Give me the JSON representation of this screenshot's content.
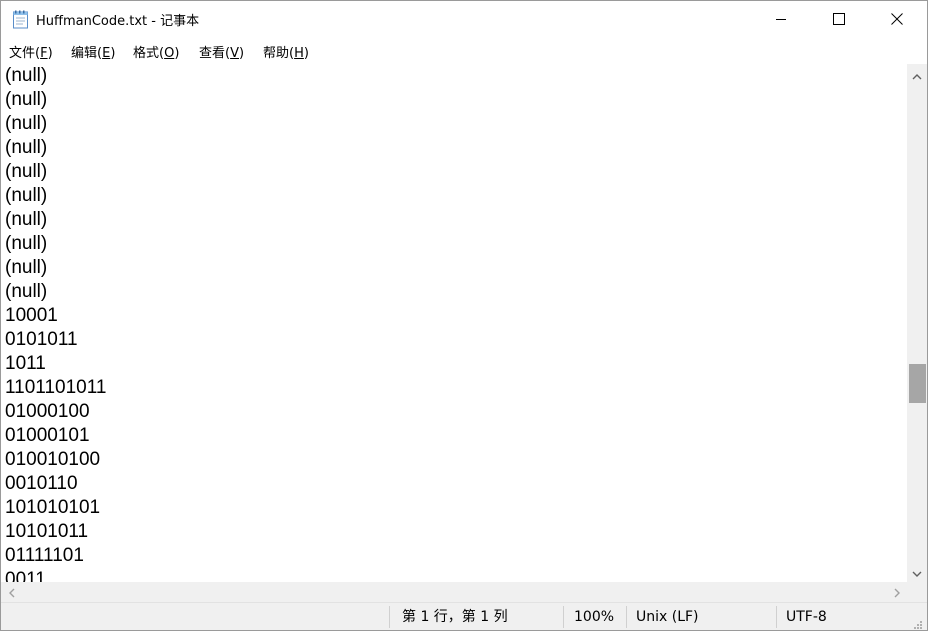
{
  "window": {
    "title": "HuffmanCode.txt - 记事本"
  },
  "menu": [
    {
      "label": "文件",
      "key": "F"
    },
    {
      "label": "编辑",
      "key": "E"
    },
    {
      "label": "格式",
      "key": "O"
    },
    {
      "label": "查看",
      "key": "V"
    },
    {
      "label": "帮助",
      "key": "H"
    }
  ],
  "editor": {
    "lines": [
      "(null)",
      "(null)",
      "(null)",
      "(null)",
      "(null)",
      "(null)",
      "(null)",
      "(null)",
      "(null)",
      "(null)",
      "10001",
      "0101011",
      "1011",
      "1101101011",
      "01000100",
      "01000101",
      "010010100",
      "0010110",
      "101010101",
      "10101011",
      "01111101",
      "0011"
    ]
  },
  "status": {
    "position": "第 1 行，第 1 列",
    "zoom": "100%",
    "line_ending": "Unix (LF)",
    "encoding": "UTF-8"
  },
  "icons": {
    "app": "notepad-icon",
    "minimize": "minimize-icon",
    "maximize": "maximize-icon",
    "close": "close-icon"
  },
  "colors": {
    "scroll_thumb": "#a6a6a6",
    "statusbar_bg": "#f0f0f0"
  }
}
